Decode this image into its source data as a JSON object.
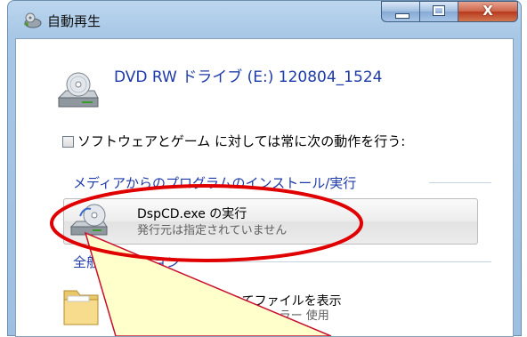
{
  "window": {
    "title": "自動再生",
    "icons": {
      "title": "autoplay-icon",
      "minimize": "minimize-icon",
      "maximize": "maximize-icon",
      "close": "close-icon"
    },
    "close_glyph": "X"
  },
  "drive": {
    "label": "DVD RW ドライブ (E:) 120804_1524",
    "icon": "dvd-drive-icon",
    "color": "#1e3aa8"
  },
  "always_option": {
    "label": "ソフトウェアとゲーム に対しては常に次の動作を行う:",
    "checked": false
  },
  "sections": {
    "install_header": "メディアからのプログラムのインストール/実行",
    "general_header": "全般のオプション"
  },
  "actions": {
    "run": {
      "title": "DspCD.exe の実行",
      "subtitle": "発行元は指定されていません",
      "icon": "cd-setup-icon"
    },
    "open_folder": {
      "title": "フォルダーを開いてファイルを表示",
      "subtitle": "エクスプローラー 使用",
      "icon": "folder-icon"
    }
  },
  "annotation": {
    "ellipse_color": "#e00000",
    "callout_fill": "#ffffcc",
    "callout_stroke": "#c8102e"
  }
}
